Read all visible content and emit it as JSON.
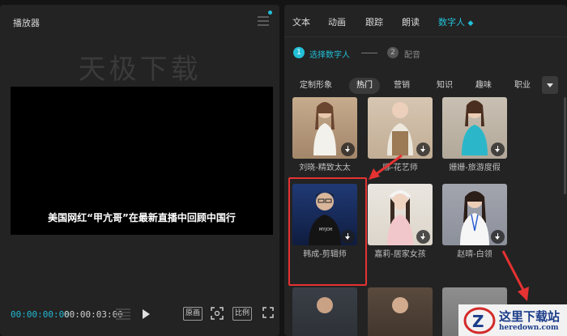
{
  "player": {
    "title": "播放器",
    "watermark": "天极下载",
    "subtitle": "美国网红“甲亢哥”在最新直播中回顾中国行",
    "time_current": "00:00:00:00",
    "time_total": "00:00:03:00",
    "btn_original": "原画",
    "btn_ratio": "比例"
  },
  "tabs": [
    "文本",
    "动画",
    "跟踪",
    "朗读",
    "数字人"
  ],
  "active_tab": "数字人",
  "steps": [
    {
      "num": "1",
      "label": "选择数字人"
    },
    {
      "num": "2",
      "label": "配音"
    }
  ],
  "categories": [
    "定制形象",
    "热门",
    "营销",
    "知识",
    "趣味",
    "职业"
  ],
  "active_category": "热门",
  "avatars": [
    {
      "label": "刘晓-精致太太",
      "bg": "#b9a28d",
      "cloth": "#f2f2ee"
    },
    {
      "label": "娜-花艺师",
      "bg": "#cdbca6",
      "cloth": "#eae6dc"
    },
    {
      "label": "姗姗-旅游度假",
      "bg": "#c0b8ac",
      "cloth": "#2bb7c9"
    },
    {
      "label": "韩成-剪辑师",
      "bg": "#15264f",
      "cloth": "#151515"
    },
    {
      "label": "嘉莉-居家女孩",
      "bg": "#e8e3dc",
      "cloth": "#f0c5c8"
    },
    {
      "label": "赵晴-白领",
      "bg": "#9a9da6",
      "cloth": "#f4f4f4"
    }
  ],
  "logo": {
    "line1": "这里下载站",
    "line2": "heredown.com"
  },
  "colors": {
    "accent": "#22c0d8",
    "highlight": "#e53232",
    "arrow": "#e53232"
  }
}
